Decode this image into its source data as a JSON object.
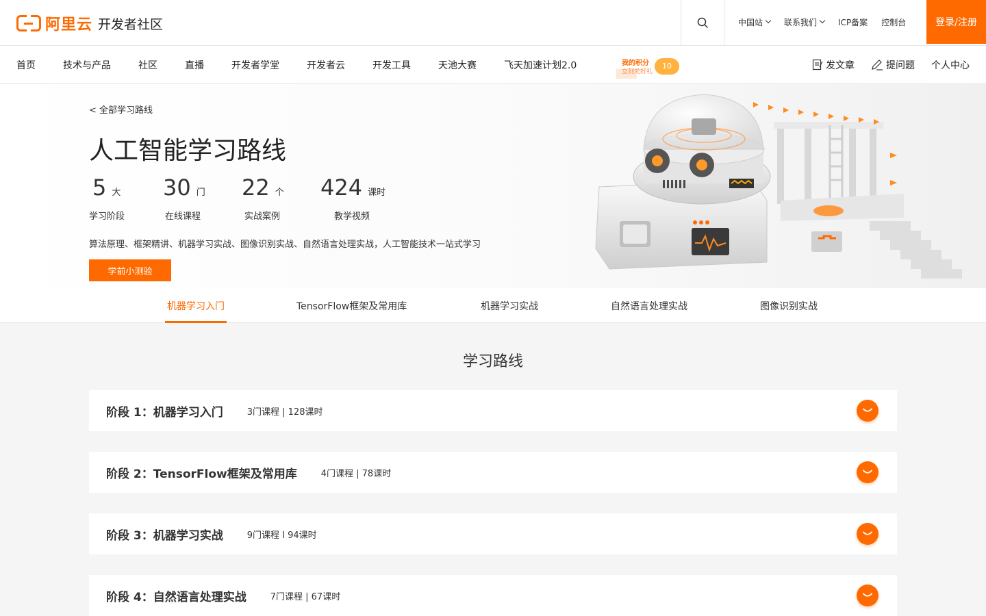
{
  "header": {
    "logo_text": "阿里云",
    "site_name": "开发者社区",
    "top_links": [
      "中国站",
      "联系我们",
      "ICP备案",
      "控制台"
    ],
    "login_label": "登录/注册"
  },
  "nav": {
    "items": [
      "首页",
      "技术与产品",
      "社区",
      "直播",
      "开发者学堂",
      "开发者云",
      "开发工具",
      "天池大赛",
      "飞天加速计划2.0"
    ],
    "points": {
      "title": "我的积分",
      "subtitle": "立刻兑好礼",
      "value": "10"
    },
    "right": [
      "发文章",
      "提问题",
      "个人中心"
    ]
  },
  "hero": {
    "back_label": "< 全部学习路线",
    "title": "人工智能学习路线",
    "stats": [
      {
        "num": "5",
        "unit": "大",
        "label": "学习阶段"
      },
      {
        "num": "30",
        "unit": "门",
        "label": "在线课程"
      },
      {
        "num": "22",
        "unit": "个",
        "label": "实战案例"
      },
      {
        "num": "424",
        "unit": "课时",
        "label": "教学视频"
      }
    ],
    "description": "算法原理、框架精讲、机器学习实战、图像识别实战、自然语言处理实战，人工智能技术一站式学习",
    "quiz_label": "学前小测验"
  },
  "tabs": [
    "机器学习入门",
    "TensorFlow框架及常用库",
    "机器学习实战",
    "自然语言处理实战",
    "图像识别实战"
  ],
  "path": {
    "title": "学习路线",
    "stages": [
      {
        "title": "阶段 1：机器学习入门",
        "meta": "3门课程 | 128课时"
      },
      {
        "title": "阶段 2：TensorFlow框架及常用库",
        "meta": "4门课程 | 78课时"
      },
      {
        "title": "阶段 3：机器学习实战",
        "meta": "9门课程 I 94课时"
      },
      {
        "title": "阶段 4：自然语言处理实战",
        "meta": "7门课程 | 67课时"
      }
    ]
  },
  "colors": {
    "accent": "#ff6a00"
  }
}
